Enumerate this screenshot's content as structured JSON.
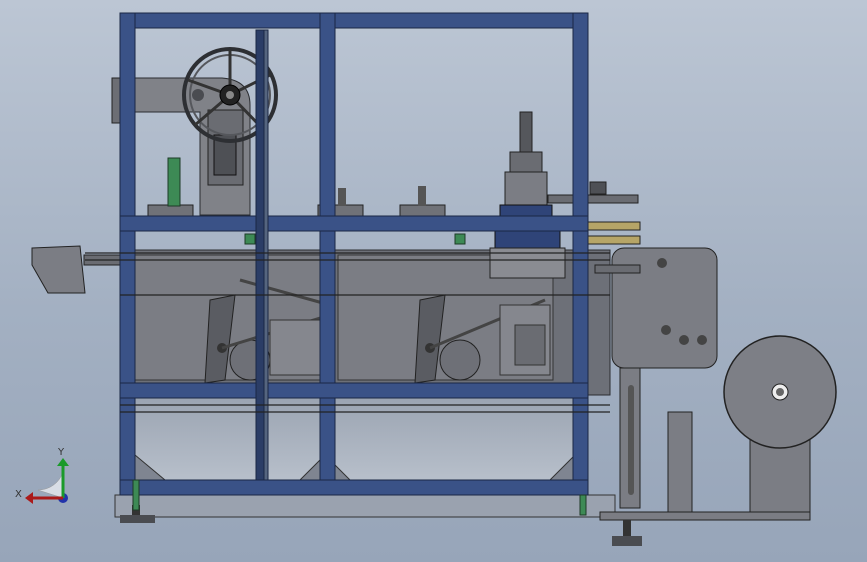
{
  "view": {
    "triad": {
      "y_label": "Y",
      "x_label": "X"
    }
  },
  "colors": {
    "frame": "#3a5287",
    "frame_edge": "#1a2744",
    "panel": "#7b7d84",
    "panel_dark": "#5e6066",
    "panel_light": "#9a9ca3",
    "guard": "#a7aebb",
    "green_block": "#3d8a55",
    "hopper": "#b7bfcc"
  }
}
